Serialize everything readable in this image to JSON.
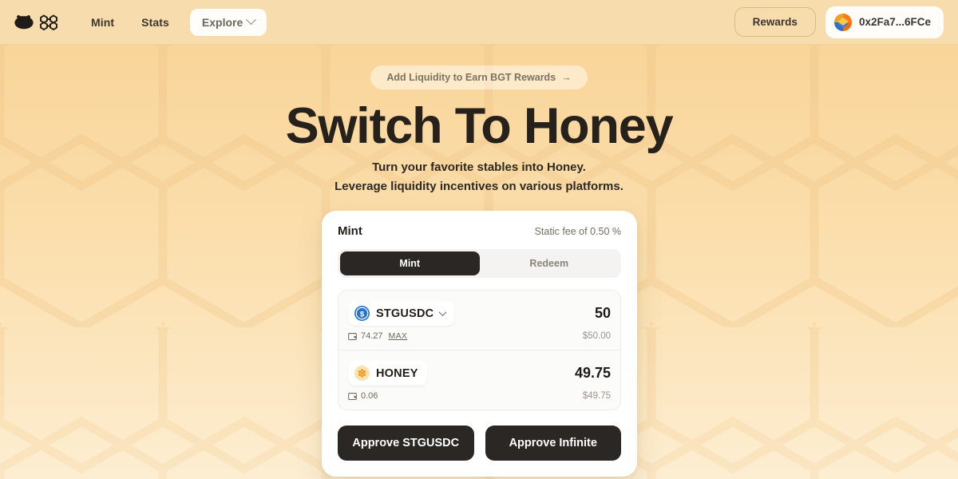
{
  "header": {
    "logo_icon": "bear-head-icon",
    "logo_mark_icon": "honeycomb-mark-icon",
    "nav": [
      {
        "label": "Mint",
        "name": "mint"
      },
      {
        "label": "Stats",
        "name": "stats"
      }
    ],
    "explore": {
      "label": "Explore",
      "chevron_icon": "chevron-down-icon"
    },
    "rewards_label": "Rewards",
    "wallet": {
      "address": "0x2Fa7...6FCe",
      "avatar_icon": "wallet-avatar-icon"
    }
  },
  "hero": {
    "promo": {
      "label": "Add Liquidity to Earn BGT Rewards",
      "arrow": "→"
    },
    "title": "Switch To Honey",
    "subtitle_line1": "Turn your favorite stables into Honey.",
    "subtitle_line2": "Leverage liquidity incentives on various platforms."
  },
  "card": {
    "title": "Mint",
    "static_fee": "Static fee of 0.50 %",
    "tabs": [
      {
        "label": "Mint",
        "active": true
      },
      {
        "label": "Redeem",
        "active": false
      }
    ],
    "rows": [
      {
        "symbol": "STGUSDC",
        "token_icon": "usdc-token-icon",
        "chevron_icon": "chevron-down-icon",
        "amount": "50",
        "balance_icon": "wallet-balance-icon",
        "balance": "74.27",
        "max_label": "MAX",
        "usd": "$50.00",
        "has_max": true
      },
      {
        "symbol": "HONEY",
        "token_icon": "honey-token-icon",
        "chevron_icon": "",
        "amount": "49.75",
        "balance_icon": "wallet-balance-icon",
        "balance": "0.06",
        "max_label": "",
        "usd": "$49.75",
        "has_max": false
      }
    ],
    "actions": [
      {
        "label": "Approve STGUSDC",
        "name": "approve-token"
      },
      {
        "label": "Approve Infinite",
        "name": "approve-infinite"
      }
    ]
  },
  "colors": {
    "bg_top": "#f8d395",
    "bg_bottom": "#fdeed2",
    "header_bg": "#f7dcae",
    "dark": "#2b2724",
    "card_bg": "#ffffff",
    "usdc_blue": "#2775ca",
    "honey_orange": "#f5a524"
  }
}
